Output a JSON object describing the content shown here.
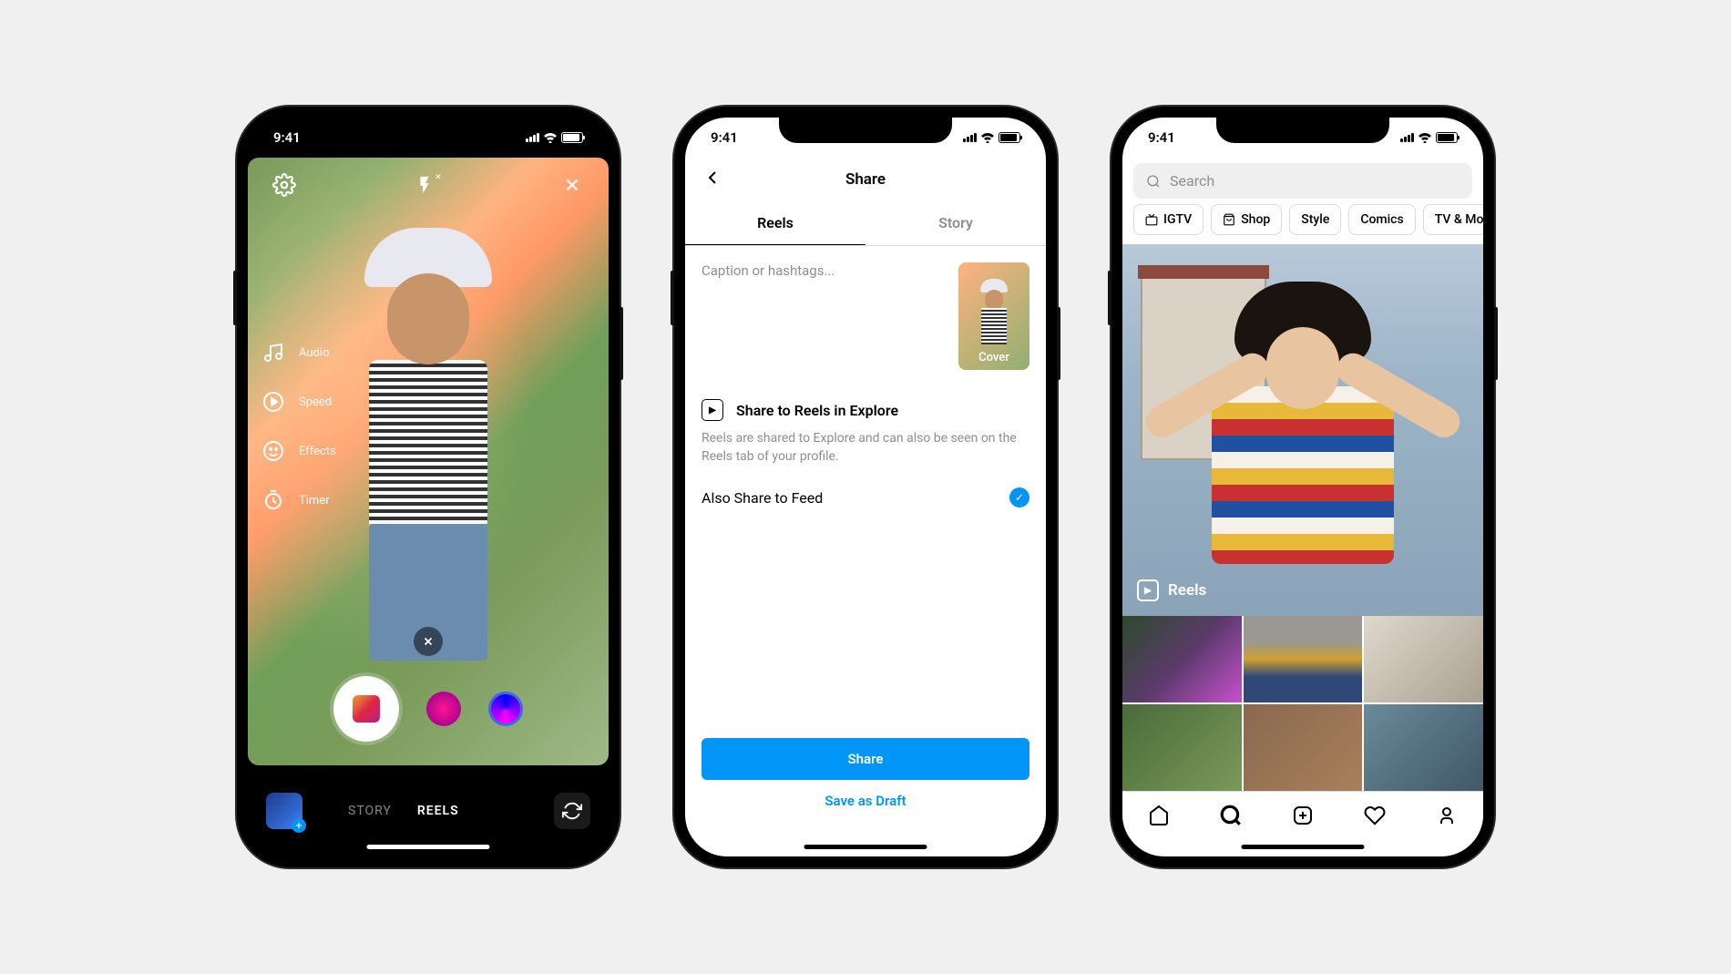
{
  "status": {
    "time": "9:41"
  },
  "phone1": {
    "tools": {
      "audio": "Audio",
      "speed": "Speed",
      "effects": "Effects",
      "timer": "Timer"
    },
    "modes": {
      "story": "STORY",
      "reels": "REELS"
    }
  },
  "phone2": {
    "title": "Share",
    "tabs": {
      "reels": "Reels",
      "story": "Story"
    },
    "caption_placeholder": "Caption or hashtags...",
    "cover_label": "Cover",
    "explore_title": "Share to Reels in Explore",
    "explore_desc": "Reels are shared to Explore and can also be seen on the Reels tab of your profile.",
    "also_feed": "Also Share to Feed",
    "share_btn": "Share",
    "draft_btn": "Save as Draft"
  },
  "phone3": {
    "search_placeholder": "Search",
    "chips": {
      "igtv": "IGTV",
      "shop": "Shop",
      "style": "Style",
      "comics": "Comics",
      "tv": "TV & Movie"
    },
    "reels_label": "Reels"
  }
}
